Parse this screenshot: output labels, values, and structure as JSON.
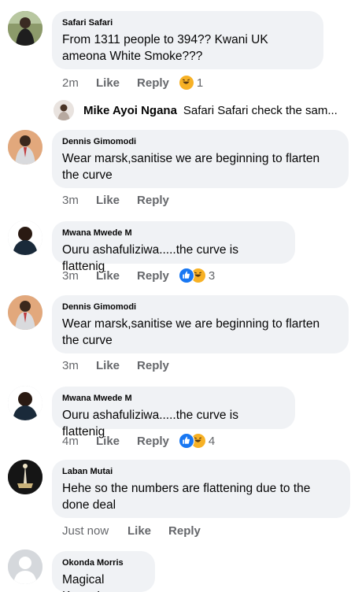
{
  "colors": {
    "bubble": "#f0f2f5",
    "meta": "#65676b",
    "like_blue": "#1877f2",
    "haha_yellow": "#f7b125"
  },
  "comments": [
    {
      "author": "Safari Safari",
      "text": "From 1311 people to 394?? Kwani UK ameona White Smoke???",
      "time": "2m",
      "like": "Like",
      "reply": "Reply",
      "reaction_count": "1",
      "reactions": [
        "haha-icon"
      ]
    },
    {
      "author": "Dennis Gimomodi",
      "text": "Wear marsk,sanitise we are beginning to flarten the curve",
      "time": "3m",
      "like": "Like",
      "reply": "Reply"
    },
    {
      "author": "Mwana Mwede M",
      "text": "Ouru ashafuliziwa.....the curve is flattenig",
      "time": "3m",
      "like": "Like",
      "reply": "Reply",
      "reaction_count": "3",
      "reactions": [
        "like-icon",
        "haha-icon"
      ]
    },
    {
      "author": "Dennis Gimomodi",
      "text": "Wear marsk,sanitise we are beginning to flarten the curve",
      "time": "3m",
      "like": "Like",
      "reply": "Reply"
    },
    {
      "author": "Mwana Mwede M",
      "text": "Ouru ashafuliziwa.....the curve is flattenig",
      "time": "4m",
      "like": "Like",
      "reply": "Reply",
      "reaction_count": "4",
      "reactions": [
        "like-icon",
        "haha-icon"
      ]
    },
    {
      "author": "Laban Mutai",
      "text": "Hehe so the numbers are flattening due to the done deal",
      "time": "Just now",
      "like": "Like",
      "reply": "Reply"
    },
    {
      "author": "Okonda Morris",
      "text": "Magical Kenya!"
    }
  ],
  "reply_preview": {
    "author": "Mike Ayoi Ngana",
    "text": "Safari Safari check the sam..."
  }
}
